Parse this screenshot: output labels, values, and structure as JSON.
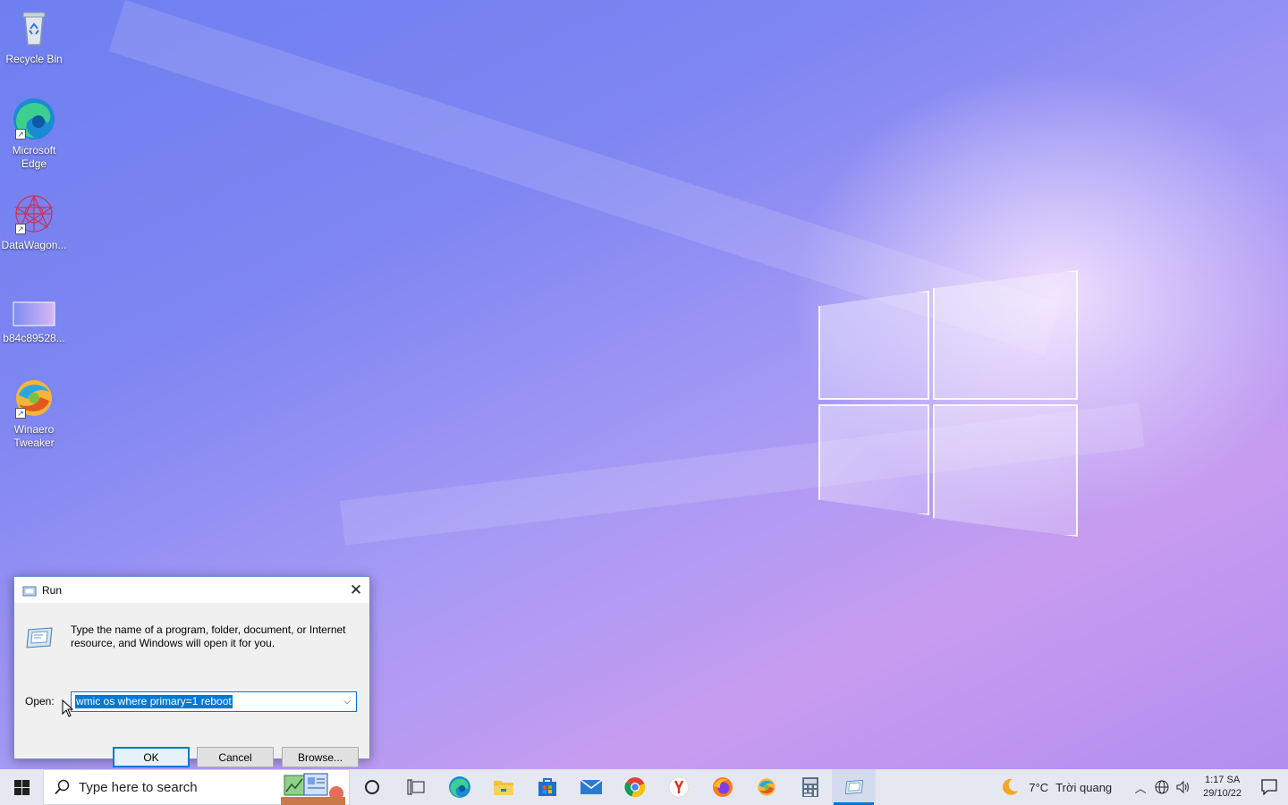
{
  "desktop": {
    "icons": [
      {
        "label": "Recycle Bin",
        "icon": "recycle-bin-icon"
      },
      {
        "label": "Microsoft Edge",
        "icon": "edge-icon"
      },
      {
        "label": "DataWagon...",
        "icon": "datawagon-icon"
      },
      {
        "label": "b84c89528...",
        "icon": "image-file-icon"
      },
      {
        "label": "Winaero Tweaker",
        "icon": "winaero-icon"
      }
    ]
  },
  "run_dialog": {
    "title": "Run",
    "description": "Type the name of a program, folder, document, or Internet resource, and Windows will open it for you.",
    "open_label": "Open:",
    "open_value": "wmic os where primary=1 reboot",
    "ok_label": "OK",
    "cancel_label": "Cancel",
    "browse_label": "Browse..."
  },
  "taskbar": {
    "search_placeholder": "Type here to search",
    "pinned": [
      "cortana-icon",
      "task-view-icon",
      "edge-icon",
      "file-explorer-icon",
      "store-icon",
      "mail-icon",
      "chrome-icon",
      "yandex-icon",
      "firefox-icon",
      "winaero-icon",
      "calculator-icon",
      "run-icon"
    ],
    "weather": {
      "temp": "7°C",
      "condition": "Trời quang"
    },
    "clock": {
      "time": "1:17 SA",
      "date": "29/10/22"
    }
  },
  "colors": {
    "accent": "#0078d7",
    "taskbar": "#e6e8f1",
    "dialog_bg": "#f0f0f0"
  }
}
